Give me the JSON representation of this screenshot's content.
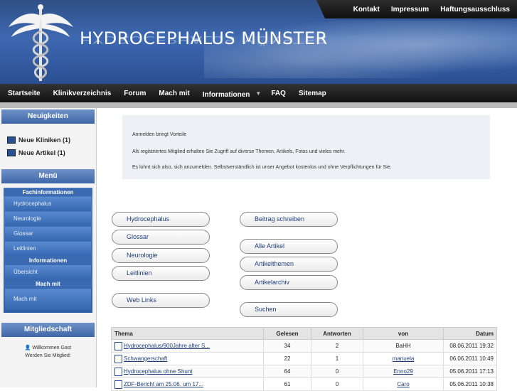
{
  "header": {
    "title": "HYDROCEPHALUS MÜNSTER",
    "top_links": [
      "Kontakt",
      "Impressum",
      "Haftungsausschluss"
    ]
  },
  "nav": {
    "items": [
      "Startseite",
      "Klinikverzeichnis",
      "Forum",
      "Mach mit",
      "Informationen",
      "FAQ",
      "Sitemap"
    ]
  },
  "sidebar": {
    "news_heading": "Neuigkeiten",
    "news_items": [
      "Neue Kliniken (1)",
      "Neue Artikel (1)"
    ],
    "menu_heading": "Menü",
    "menu_sections": [
      {
        "title": "Fachinformationen",
        "items": [
          "Hydrocephalus",
          "Neurologie",
          "Glossar",
          "Leitlinien"
        ]
      },
      {
        "title": "Informationen",
        "items": [
          "Übersicht"
        ]
      },
      {
        "title": "Mach mit",
        "items": [
          "Mach mit"
        ]
      }
    ],
    "member_heading": "Mitgliedschaft",
    "welcome": "Willkommen Gast",
    "become_member": "Werden Sie Mitglied:"
  },
  "info": {
    "line1": "Anmelden bringt Vorteile",
    "line2": "Als registriertes Mitglied erhalten Sie Zugriff auf diverse Themen, Artikels, Fotos und vieles mehr.",
    "line3": "Es lohnt sich also, sich anzumelden. Selbstverständlich ist unser Angebot kostenlos und ohne Verpflichtungen für Sie."
  },
  "buttons_left": [
    "Hydrocephalus",
    "Glossar",
    "Neurologie",
    "Leitlinien",
    "Web Links"
  ],
  "buttons_right": [
    "Beitrag schreiben",
    "Alle Artikel",
    "Artikelthemen",
    "Artikelarchiv",
    "Suchen"
  ],
  "table": {
    "headers": [
      "Thema",
      "Gelesen",
      "Antworten",
      "von",
      "Datum"
    ],
    "rows": [
      {
        "thema": "Hydrocephalus/900Jahre alter S...",
        "gelesen": "34",
        "antworten": "2",
        "von": "BaHH",
        "von_link": false,
        "datum": "08.06.2011 19:32"
      },
      {
        "thema": "Schwangerschaft",
        "gelesen": "22",
        "antworten": "1",
        "von": "manuela",
        "von_link": true,
        "datum": "06.06.2011 10:49"
      },
      {
        "thema": "Hydrocephalus ohne Shunt",
        "gelesen": "64",
        "antworten": "0",
        "von": "Enno29",
        "von_link": true,
        "datum": "05.06.2011 17:13"
      },
      {
        "thema": "ZDF-Bericht am 25.06. um 17...",
        "gelesen": "61",
        "antworten": "0",
        "von": "Caro",
        "von_link": true,
        "datum": "05.06.2011 10:38"
      }
    ]
  },
  "colors": {
    "brand_blue": "#2a4f93",
    "nav_dark": "#1a1a1a",
    "link": "#1f3f7a"
  }
}
